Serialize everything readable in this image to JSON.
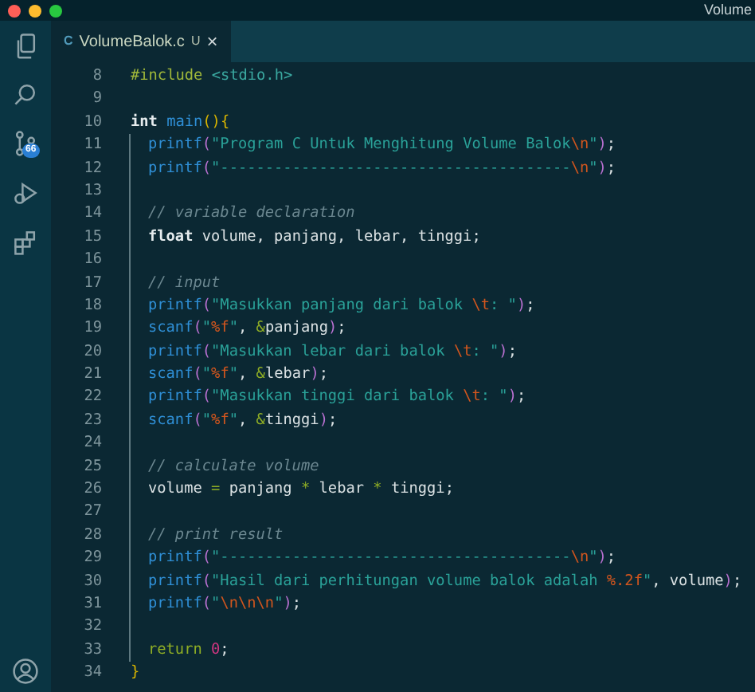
{
  "window": {
    "title": "Volume"
  },
  "activity_bar": {
    "items": [
      {
        "kind": "files",
        "selected": false
      },
      {
        "kind": "search",
        "selected": false
      },
      {
        "kind": "source-control",
        "selected": false,
        "badge": "66"
      },
      {
        "kind": "run",
        "selected": false
      },
      {
        "kind": "extensions",
        "selected": false
      }
    ],
    "account": {
      "kind": "account"
    }
  },
  "tabs": [
    {
      "icon": "C",
      "label": "VolumeBalok.c",
      "status": "U",
      "close": "×",
      "selected": true
    }
  ],
  "lines": [
    {
      "number": "8",
      "indented": false,
      "tokens": [
        {
          "kind": "directive",
          "text": "#include "
        },
        {
          "kind": "header",
          "text": "<stdio.h>"
        }
      ]
    },
    {
      "number": "9",
      "indented": false
    },
    {
      "number": "10",
      "indented": false,
      "tokens": [
        {
          "kind": "type",
          "text": "int "
        },
        {
          "kind": "function",
          "text": "main"
        },
        {
          "kind": "brace",
          "text": "(){"
        }
      ]
    },
    {
      "number": "11",
      "indented": true,
      "tokens": [
        {
          "kind": "function",
          "text": "printf"
        },
        {
          "kind": "paren",
          "text": "("
        },
        {
          "kind": "string",
          "text": "\"Program C Untuk Menghitung Volume Balok"
        },
        {
          "kind": "escape",
          "text": "\\n"
        },
        {
          "kind": "string",
          "text": "\""
        },
        {
          "kind": "paren",
          "text": ")"
        },
        {
          "kind": "plain",
          "text": ";"
        }
      ]
    },
    {
      "number": "12",
      "indented": true,
      "tokens": [
        {
          "kind": "function",
          "text": "printf"
        },
        {
          "kind": "paren",
          "text": "("
        },
        {
          "kind": "string",
          "text": "\"---------------------------------------"
        },
        {
          "kind": "escape",
          "text": "\\n"
        },
        {
          "kind": "string",
          "text": "\""
        },
        {
          "kind": "paren",
          "text": ")"
        },
        {
          "kind": "plain",
          "text": ";"
        }
      ]
    },
    {
      "number": "13",
      "indented": true
    },
    {
      "number": "14",
      "indented": true,
      "tokens": [
        {
          "kind": "comment",
          "text": "// variable declaration"
        }
      ]
    },
    {
      "number": "15",
      "indented": true,
      "tokens": [
        {
          "kind": "type",
          "text": "float"
        },
        {
          "kind": "plain",
          "text": " volume, panjang, lebar, tinggi;"
        }
      ]
    },
    {
      "number": "16",
      "indented": true
    },
    {
      "number": "17",
      "indented": true,
      "tokens": [
        {
          "kind": "comment",
          "text": "// input"
        }
      ]
    },
    {
      "number": "18",
      "indented": true,
      "tokens": [
        {
          "kind": "function",
          "text": "printf"
        },
        {
          "kind": "paren",
          "text": "("
        },
        {
          "kind": "string",
          "text": "\"Masukkan panjang dari balok "
        },
        {
          "kind": "escape",
          "text": "\\t"
        },
        {
          "kind": "string",
          "text": ": \""
        },
        {
          "kind": "paren",
          "text": ")"
        },
        {
          "kind": "plain",
          "text": ";"
        }
      ]
    },
    {
      "number": "19",
      "indented": true,
      "tokens": [
        {
          "kind": "function",
          "text": "scanf"
        },
        {
          "kind": "paren",
          "text": "("
        },
        {
          "kind": "string",
          "text": "\""
        },
        {
          "kind": "format",
          "text": "%f"
        },
        {
          "kind": "string",
          "text": "\""
        },
        {
          "kind": "plain",
          "text": ", "
        },
        {
          "kind": "operator",
          "text": "&"
        },
        {
          "kind": "plain",
          "text": "panjang"
        },
        {
          "kind": "paren",
          "text": ")"
        },
        {
          "kind": "plain",
          "text": ";"
        }
      ]
    },
    {
      "number": "20",
      "indented": true,
      "tokens": [
        {
          "kind": "function",
          "text": "printf"
        },
        {
          "kind": "paren",
          "text": "("
        },
        {
          "kind": "string",
          "text": "\"Masukkan lebar dari balok "
        },
        {
          "kind": "escape",
          "text": "\\t"
        },
        {
          "kind": "string",
          "text": ": \""
        },
        {
          "kind": "paren",
          "text": ")"
        },
        {
          "kind": "plain",
          "text": ";"
        }
      ]
    },
    {
      "number": "21",
      "indented": true,
      "tokens": [
        {
          "kind": "function",
          "text": "scanf"
        },
        {
          "kind": "paren",
          "text": "("
        },
        {
          "kind": "string",
          "text": "\""
        },
        {
          "kind": "format",
          "text": "%f"
        },
        {
          "kind": "string",
          "text": "\""
        },
        {
          "kind": "plain",
          "text": ", "
        },
        {
          "kind": "operator",
          "text": "&"
        },
        {
          "kind": "plain",
          "text": "lebar"
        },
        {
          "kind": "paren",
          "text": ")"
        },
        {
          "kind": "plain",
          "text": ";"
        }
      ]
    },
    {
      "number": "22",
      "indented": true,
      "tokens": [
        {
          "kind": "function",
          "text": "printf"
        },
        {
          "kind": "paren",
          "text": "("
        },
        {
          "kind": "string",
          "text": "\"Masukkan tinggi dari balok "
        },
        {
          "kind": "escape",
          "text": "\\t"
        },
        {
          "kind": "string",
          "text": ": \""
        },
        {
          "kind": "paren",
          "text": ")"
        },
        {
          "kind": "plain",
          "text": ";"
        }
      ]
    },
    {
      "number": "23",
      "indented": true,
      "tokens": [
        {
          "kind": "function",
          "text": "scanf"
        },
        {
          "kind": "paren",
          "text": "("
        },
        {
          "kind": "string",
          "text": "\""
        },
        {
          "kind": "format",
          "text": "%f"
        },
        {
          "kind": "string",
          "text": "\""
        },
        {
          "kind": "plain",
          "text": ", "
        },
        {
          "kind": "operator",
          "text": "&"
        },
        {
          "kind": "plain",
          "text": "tinggi"
        },
        {
          "kind": "paren",
          "text": ")"
        },
        {
          "kind": "plain",
          "text": ";"
        }
      ]
    },
    {
      "number": "24",
      "indented": true
    },
    {
      "number": "25",
      "indented": true,
      "tokens": [
        {
          "kind": "comment",
          "text": "// calculate volume"
        }
      ]
    },
    {
      "number": "26",
      "indented": true,
      "tokens": [
        {
          "kind": "plain",
          "text": "volume "
        },
        {
          "kind": "operator",
          "text": "="
        },
        {
          "kind": "plain",
          "text": " panjang "
        },
        {
          "kind": "operator",
          "text": "*"
        },
        {
          "kind": "plain",
          "text": " lebar "
        },
        {
          "kind": "operator",
          "text": "*"
        },
        {
          "kind": "plain",
          "text": " tinggi;"
        }
      ]
    },
    {
      "number": "27",
      "indented": true
    },
    {
      "number": "28",
      "indented": true,
      "tokens": [
        {
          "kind": "comment",
          "text": "// print result"
        }
      ]
    },
    {
      "number": "29",
      "indented": true,
      "tokens": [
        {
          "kind": "function",
          "text": "printf"
        },
        {
          "kind": "paren",
          "text": "("
        },
        {
          "kind": "string",
          "text": "\"---------------------------------------"
        },
        {
          "kind": "escape",
          "text": "\\n"
        },
        {
          "kind": "string",
          "text": "\""
        },
        {
          "kind": "paren",
          "text": ")"
        },
        {
          "kind": "plain",
          "text": ";"
        }
      ]
    },
    {
      "number": "30",
      "indented": true,
      "tokens": [
        {
          "kind": "function",
          "text": "printf"
        },
        {
          "kind": "paren",
          "text": "("
        },
        {
          "kind": "string",
          "text": "\"Hasil dari perhitungan volume balok adalah "
        },
        {
          "kind": "format",
          "text": "%.2f"
        },
        {
          "kind": "string",
          "text": "\""
        },
        {
          "kind": "plain",
          "text": ", volume"
        },
        {
          "kind": "paren",
          "text": ")"
        },
        {
          "kind": "plain",
          "text": ";"
        }
      ]
    },
    {
      "number": "31",
      "indented": true,
      "tokens": [
        {
          "kind": "function",
          "text": "printf"
        },
        {
          "kind": "paren",
          "text": "("
        },
        {
          "kind": "string",
          "text": "\""
        },
        {
          "kind": "escape",
          "text": "\\n\\n\\n"
        },
        {
          "kind": "string",
          "text": "\""
        },
        {
          "kind": "paren",
          "text": ")"
        },
        {
          "kind": "plain",
          "text": ";"
        }
      ]
    },
    {
      "number": "32",
      "indented": true
    },
    {
      "number": "33",
      "indented": true,
      "tokens": [
        {
          "kind": "keyword",
          "text": "return "
        },
        {
          "kind": "number",
          "text": "0"
        },
        {
          "kind": "plain",
          "text": ";"
        }
      ]
    },
    {
      "number": "34",
      "indented": false,
      "tokens": [
        {
          "kind": "brace",
          "text": "}"
        }
      ]
    }
  ]
}
